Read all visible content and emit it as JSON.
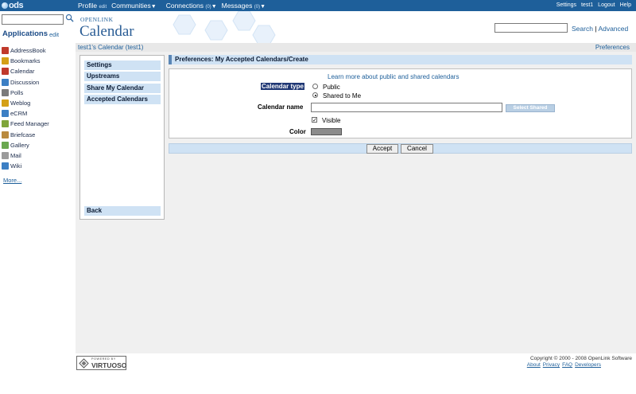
{
  "topbar": {
    "logo_text": "ods",
    "nav": {
      "profile": "Profile",
      "profile_edit": "edit",
      "communities": "Communities",
      "connections": "Connections",
      "connections_count": "(0)",
      "messages": "Messages",
      "messages_count": "(0)"
    },
    "right": {
      "settings": "Settings",
      "user": "test1",
      "logout": "Logout",
      "help": "Help"
    }
  },
  "sidebar": {
    "applications_title": "Applications",
    "applications_edit": "edit",
    "items": [
      {
        "label": "AddressBook",
        "icon": "addressbook-icon",
        "color": "#c0392b"
      },
      {
        "label": "Bookmarks",
        "icon": "bookmarks-icon",
        "color": "#d4a017"
      },
      {
        "label": "Calendar",
        "icon": "calendar-icon",
        "color": "#c0392b"
      },
      {
        "label": "Discussion",
        "icon": "discussion-icon",
        "color": "#3c7fc4"
      },
      {
        "label": "Polls",
        "icon": "polls-icon",
        "color": "#7a7a7a"
      },
      {
        "label": "Weblog",
        "icon": "weblog-icon",
        "color": "#d4a017"
      },
      {
        "label": "eCRM",
        "icon": "ecrm-icon",
        "color": "#3c7fc4"
      },
      {
        "label": "Feed Manager",
        "icon": "feed-icon",
        "color": "#7fa53a"
      },
      {
        "label": "Briefcase",
        "icon": "briefcase-icon",
        "color": "#b98a3e"
      },
      {
        "label": "Gallery",
        "icon": "gallery-icon",
        "color": "#6aa84f"
      },
      {
        "label": "Mail",
        "icon": "mail-icon",
        "color": "#9b9b9b"
      },
      {
        "label": "Wiki",
        "icon": "wiki-icon",
        "color": "#3c7fc4"
      }
    ],
    "more": "More..."
  },
  "header": {
    "brand_small": "OPENLINK",
    "brand": "Calendar",
    "search_link": "Search",
    "separator": "|",
    "advanced_link": "Advanced"
  },
  "subbar": {
    "breadcrumb": "test1's Calendar (test1)",
    "preferences": "Preferences"
  },
  "settings_menu": {
    "items": [
      "Settings",
      "Upstreams",
      "Share My Calendar",
      "Accepted Calendars"
    ],
    "back": "Back"
  },
  "preferences": {
    "title": "Preferences: My Accepted Calendars/Create",
    "learn_more": "Learn more about public and shared calendars",
    "calendar_type_label": "Calendar type",
    "option_public": "Public",
    "option_shared": "Shared to Me",
    "selected_option": "Shared to Me",
    "calendar_name_label": "Calendar name",
    "calendar_name_value": "",
    "select_shared_button": "Select Shared",
    "visible_label": "Visible",
    "visible_checked": true,
    "color_label": "Color",
    "color_value": "#8c8c8c"
  },
  "actions": {
    "accept": "Accept",
    "cancel": "Cancel"
  },
  "footer": {
    "powered_by": "POWERED BY",
    "virtuoso": "VIRTUOSO",
    "copyright": "Copyright © 2000 - 2008 OpenLink Software",
    "links": [
      "About",
      "Privacy",
      "FAQ",
      "Developers"
    ]
  },
  "colors": {
    "topbar": "#1e5f9a",
    "accent_light": "#cfe2f4",
    "link": "#1e5f9a",
    "selected_label_bg": "#1f3774"
  }
}
